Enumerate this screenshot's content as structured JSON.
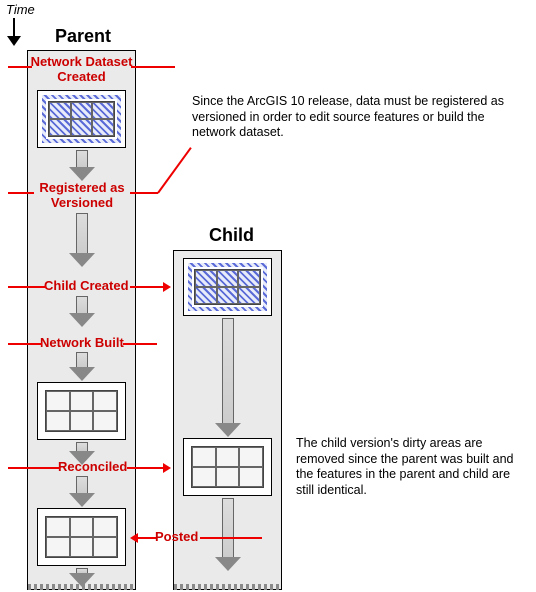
{
  "time_label": "Time",
  "columns": {
    "parent": "Parent",
    "child": "Child"
  },
  "steps": {
    "network_dataset_created": "Network Dataset\nCreated",
    "registered_as_versioned": "Registered as\nVersioned",
    "child_created": "Child Created",
    "network_built": "Network Built",
    "reconciled": "Reconciled",
    "posted": "Posted"
  },
  "notes": {
    "versioning": "Since the ArcGIS 10 release, data must be registered as versioned in order to edit source features or build the network dataset.",
    "reconciled": "The child version's dirty areas are removed since the parent was built and the features in the parent and child are still identical."
  },
  "chart_data": {
    "type": "flow-diagram",
    "lanes": [
      "Parent",
      "Child"
    ],
    "events": [
      {
        "lane": "Parent",
        "label": "Network Dataset Created",
        "state": "dirty"
      },
      {
        "lane": "Parent",
        "label": "Registered as Versioned"
      },
      {
        "lane": "Parent",
        "label": "Child Created",
        "spawns": "Child"
      },
      {
        "lane": "Child",
        "state": "dirty"
      },
      {
        "lane": "Parent",
        "label": "Network Built",
        "state": "clean"
      },
      {
        "lane": "Child",
        "label": "Reconciled",
        "state": "clean"
      },
      {
        "lane": "Parent",
        "label": "Posted",
        "from": "Child",
        "state": "clean"
      }
    ]
  }
}
